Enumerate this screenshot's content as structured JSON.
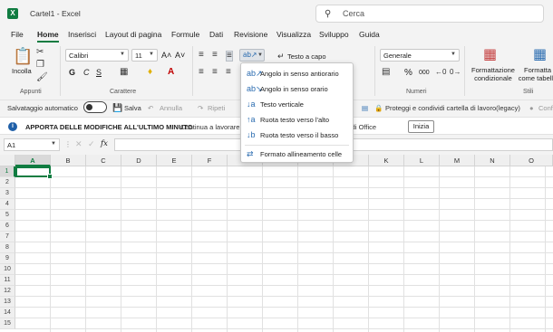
{
  "titlebar": {
    "logo": "X",
    "doc_title": "Cartel1  -  Excel",
    "search_placeholder": "Cerca"
  },
  "tabs": [
    "File",
    "Home",
    "Inserisci",
    "Layout di pagina",
    "Formule",
    "Dati",
    "Revisione",
    "Visualizza",
    "Sviluppo",
    "Guida"
  ],
  "ribbon": {
    "clipboard": {
      "paste": "Incolla",
      "label": "Appunti"
    },
    "font": {
      "name": "Calibri",
      "size": "11",
      "label": "Carattere",
      "bold": "G",
      "italic": "C",
      "underline": "S",
      "grow": "A˄",
      "shrink": "A˅"
    },
    "alignment": {
      "wrap_text": "Testo a capo"
    },
    "number": {
      "format": "Generale",
      "label": "Numeri",
      "percent": "%",
      "thousands": "000"
    },
    "styles": {
      "conditional": "Formattazione condizionale",
      "table": "Formatta come tabella",
      "label": "Stili"
    }
  },
  "quickbar": {
    "autosave": "Salvataggio automatico",
    "save": "Salva",
    "undo": "Annulla",
    "redo": "Ripeti",
    "protect": "Proteggi e condividi cartella di lavoro(legacy)",
    "confirm": "Conf"
  },
  "infobar": {
    "icon": "i",
    "title": "APPORTA DELLE MODIFICHE ALL'ULTIMO MINUTO",
    "text": "Continua a lavorare",
    "text2": "mobili di Office",
    "button": "Inizia"
  },
  "formula": {
    "cell_ref": "A1",
    "fx": "fx"
  },
  "grid": {
    "columns": [
      "A",
      "B",
      "C",
      "D",
      "E",
      "F",
      "G",
      "H",
      "I",
      "J",
      "K",
      "L",
      "M",
      "N",
      "O"
    ],
    "rows": [
      "1",
      "2",
      "3",
      "4",
      "5",
      "6",
      "7",
      "8",
      "9",
      "10",
      "11",
      "12",
      "13",
      "14",
      "15"
    ]
  },
  "dropdown": {
    "items": [
      {
        "label": "Angolo in senso antiorario",
        "icon": "ab↗"
      },
      {
        "label": "Angolo in senso orario",
        "icon": "ab↘"
      },
      {
        "label": "Testo verticale",
        "icon": "↓a"
      },
      {
        "label": "Ruota testo verso l'alto",
        "icon": "↑a"
      },
      {
        "label": "Ruota testo verso il basso",
        "icon": "↓b"
      },
      {
        "label": "Formato allineamento celle",
        "icon": "⇄"
      }
    ]
  },
  "colors": {
    "accent": "#107c41",
    "info": "#1f5fa8",
    "menu_icon": "#2b6cb0"
  }
}
